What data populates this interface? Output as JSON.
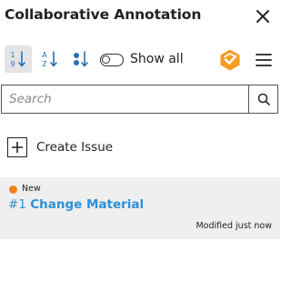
{
  "header": {
    "title": "Collaborative Annotation",
    "close_icon": "close-icon"
  },
  "toolbar": {
    "sort_ascending_icon": "sort-1-9-icon",
    "sort_alpha_icon": "sort-a-z-icon",
    "sort_status_icon": "sort-status-icon",
    "show_all_label": "Show all",
    "show_all_enabled": false,
    "logo_icon": "brand-logo-icon",
    "menu_icon": "hamburger-menu-icon",
    "accent_color": "#f59a23"
  },
  "search": {
    "placeholder": "Search",
    "value": "",
    "icon": "search-icon"
  },
  "create_issue": {
    "label": "Create Issue",
    "icon": "plus-icon"
  },
  "issues": [
    {
      "status": "New",
      "status_color": "#f0831e",
      "number": "#1",
      "title": "Change Material",
      "modified": "Modified just now",
      "title_color": "#2e8fd6"
    }
  ]
}
